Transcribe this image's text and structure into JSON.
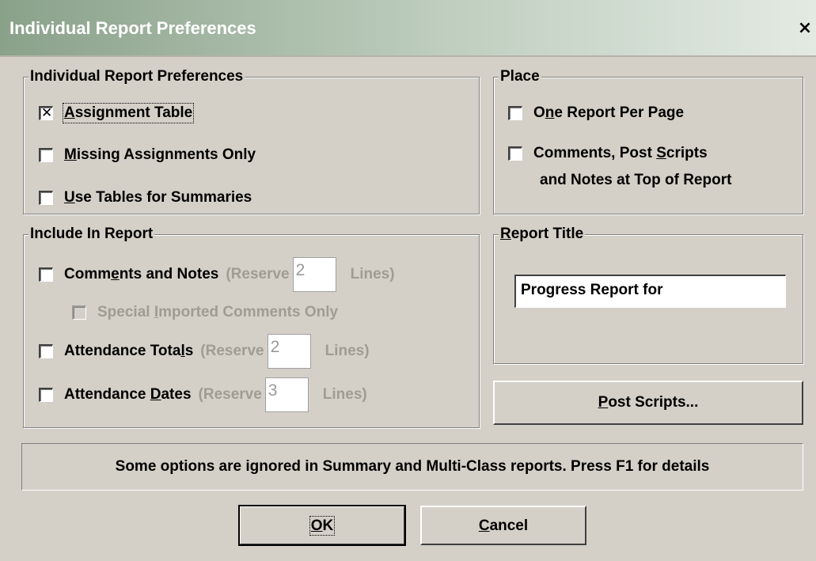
{
  "window": {
    "title": "Individual Report Preferences",
    "close_icon": "×"
  },
  "prefs": {
    "legend": "Individual Report Preferences",
    "items": [
      {
        "pre": "",
        "ul": "A",
        "post": "ssignment Table",
        "checked": true
      },
      {
        "pre": "",
        "ul": "M",
        "post": "issing Assignments Only",
        "checked": false
      },
      {
        "pre": "",
        "ul": "U",
        "post": "se Tables for Summaries",
        "checked": false
      }
    ]
  },
  "place": {
    "legend": "Place",
    "one_report": {
      "pre": "O",
      "ul": "n",
      "post": "e Report Per Page",
      "checked": false
    },
    "comments_top": {
      "line1_pre": "Comments, Post ",
      "line1_ul": "S",
      "line1_post": "cripts",
      "line2": "and Notes at Top of Report",
      "checked": false
    }
  },
  "include": {
    "legend": "Include In Report",
    "comments": {
      "pre": "Comm",
      "ul": "e",
      "post": "nts and Notes",
      "reserve": "(Reserve",
      "value": "2",
      "lines": "Lines)",
      "checked": false
    },
    "special": {
      "pre": "Special ",
      "ul": "I",
      "post": "mported Comments Only",
      "checked": false
    },
    "att_totals": {
      "pre": "Attendance Tota",
      "ul": "l",
      "post": "s",
      "reserve": "(Reserve",
      "value": "2",
      "lines": "Lines)",
      "checked": false
    },
    "att_dates": {
      "pre": "Attendance ",
      "ul": "D",
      "post": "ates",
      "reserve": "(Reserve",
      "value": "3",
      "lines": "Lines)",
      "checked": false
    }
  },
  "report_title": {
    "legend_ul": "R",
    "legend_post": "eport Title",
    "value": "Progress Report for"
  },
  "post_scripts_button": {
    "ul": "P",
    "post": "ost Scripts..."
  },
  "notice": "Some options are ignored in Summary and Multi-Class reports. Press F1 for details",
  "ok_button": {
    "ul": "O",
    "post": "K"
  },
  "cancel_button": {
    "ul": "C",
    "post": "ancel"
  },
  "check_mark": "✕"
}
